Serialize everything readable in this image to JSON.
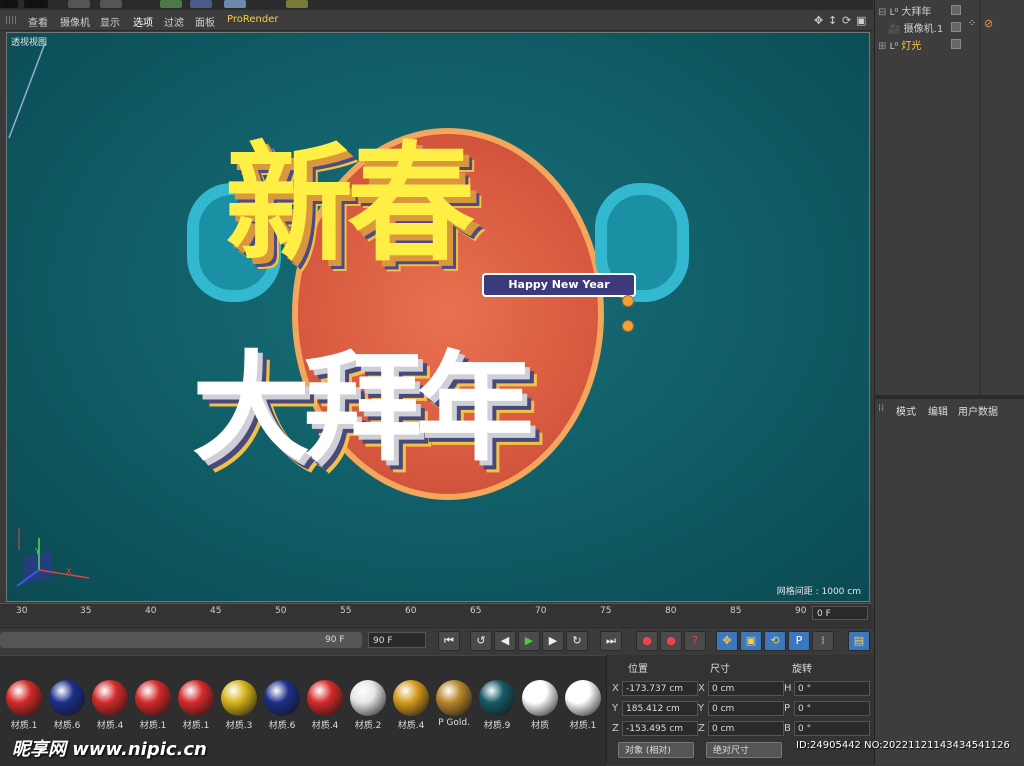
{
  "viewport_menu": [
    "查看",
    "摄像机",
    "显示",
    "选项",
    "过滤",
    "面板",
    "ProRender"
  ],
  "viewport": {
    "label": "透视视图",
    "grid_spacing": "网格间距 : 1000 cm",
    "scene_text": {
      "line1": "新春",
      "badge": "Happy New Year",
      "line2": "大拜年"
    }
  },
  "timeline": {
    "ticks": [
      "30",
      "35",
      "40",
      "45",
      "50",
      "55",
      "60",
      "65",
      "70",
      "75",
      "80",
      "85",
      "90"
    ],
    "current_frame": "0 F",
    "range_label": "90 F",
    "end_frame": "90 F"
  },
  "materials": [
    {
      "label": "材质.1",
      "color": "#d42a2a"
    },
    {
      "label": "材质.6",
      "color": "#1c2f8a"
    },
    {
      "label": "材质.4",
      "color": "#d42a2a"
    },
    {
      "label": "材质.1",
      "color": "#d42a2a"
    },
    {
      "label": "材质.1",
      "color": "#d42a2a"
    },
    {
      "label": "材质.3",
      "color": "#d6b41c"
    },
    {
      "label": "材质.6",
      "color": "#1c2f8a"
    },
    {
      "label": "材质.4",
      "color": "#d42a2a"
    },
    {
      "label": "材质.2",
      "color": "#e6e6e6"
    },
    {
      "label": "材质.4",
      "color": "#d49a1c"
    },
    {
      "label": "P Gold.",
      "color": "#b8862a"
    },
    {
      "label": "材质.9",
      "color": "#145a66"
    },
    {
      "label": "材质",
      "color": "#ffffff"
    },
    {
      "label": "材质.1",
      "color": "#ffffff"
    }
  ],
  "coordinates": {
    "headers": [
      "位置",
      "尺寸",
      "旋转"
    ],
    "position": {
      "x": "-173.737 cm",
      "y": "185.412 cm",
      "z": "-153.495 cm"
    },
    "size": {
      "x": "0 cm",
      "y": "0 cm",
      "z": "0 cm"
    },
    "rotation": {
      "h": "0 °",
      "p": "0 °",
      "b": "0 °"
    },
    "mode_select": "对象 (相对)",
    "size_select": "绝对尺寸"
  },
  "objects": [
    {
      "name": "大拜年",
      "color": "#dddddd"
    },
    {
      "name": "摄像机.1",
      "color": "#dddddd"
    },
    {
      "name": "灯光",
      "color": "#ffcc44"
    }
  ],
  "attribute_tabs": [
    "模式",
    "编辑",
    "用户数据"
  ],
  "watermark": "昵享网 www.nipic.cn",
  "id_line": "ID:24905442 NO:20221121143434541126"
}
